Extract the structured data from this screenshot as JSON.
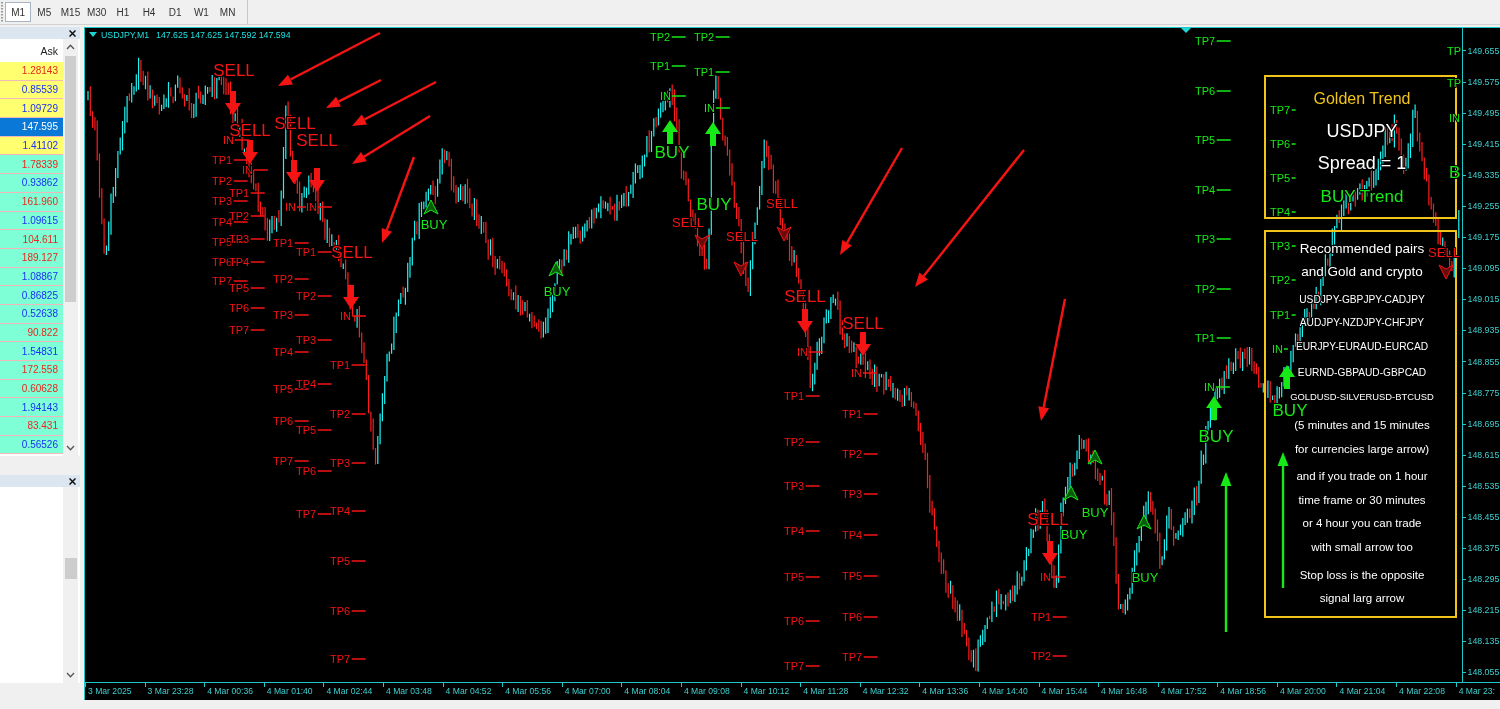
{
  "toolbar": {
    "timeframes": [
      {
        "label": "M1",
        "selected": true
      },
      {
        "label": "M5",
        "selected": false
      },
      {
        "label": "M15",
        "selected": false
      },
      {
        "label": "M30",
        "selected": false
      },
      {
        "label": "H1",
        "selected": false
      },
      {
        "label": "H4",
        "selected": false
      },
      {
        "label": "D1",
        "selected": false
      },
      {
        "label": "W1",
        "selected": false
      },
      {
        "label": "MN",
        "selected": false
      }
    ]
  },
  "market_watch": {
    "column": "Ask",
    "rows": [
      {
        "ask": "1.28143",
        "rising": false,
        "highlighted": true,
        "selected": false
      },
      {
        "ask": "0.85539",
        "rising": true,
        "highlighted": true,
        "selected": false
      },
      {
        "ask": "1.09729",
        "rising": true,
        "highlighted": true,
        "selected": false
      },
      {
        "ask": "147.595",
        "rising": true,
        "highlighted": true,
        "selected": true
      },
      {
        "ask": "1.41102",
        "rising": true,
        "highlighted": true,
        "selected": false
      },
      {
        "ask": "1.78339",
        "rising": false,
        "highlighted": false,
        "selected": false
      },
      {
        "ask": "0.93862",
        "rising": true,
        "highlighted": false,
        "selected": false
      },
      {
        "ask": "161.960",
        "rising": false,
        "highlighted": false,
        "selected": false
      },
      {
        "ask": "1.09615",
        "rising": true,
        "highlighted": false,
        "selected": false
      },
      {
        "ask": "104.611",
        "rising": false,
        "highlighted": false,
        "selected": false
      },
      {
        "ask": "189.127",
        "rising": false,
        "highlighted": false,
        "selected": false
      },
      {
        "ask": "1.08867",
        "rising": true,
        "highlighted": false,
        "selected": false
      },
      {
        "ask": "0.86825",
        "rising": true,
        "highlighted": false,
        "selected": false
      },
      {
        "ask": "0.52638",
        "rising": true,
        "highlighted": false,
        "selected": false
      },
      {
        "ask": "90.822",
        "rising": false,
        "highlighted": false,
        "selected": false
      },
      {
        "ask": "1.54831",
        "rising": true,
        "highlighted": false,
        "selected": false
      },
      {
        "ask": "172.558",
        "rising": false,
        "highlighted": false,
        "selected": false
      },
      {
        "ask": "0.60628",
        "rising": false,
        "highlighted": false,
        "selected": false
      },
      {
        "ask": "1.94143",
        "rising": true,
        "highlighted": false,
        "selected": false
      },
      {
        "ask": "83.431",
        "rising": false,
        "highlighted": false,
        "selected": false
      },
      {
        "ask": "0.56526",
        "rising": true,
        "highlighted": false,
        "selected": false
      }
    ]
  },
  "chart": {
    "title": "USDJPY,M1",
    "ohlc": "147.625 147.625 147.592 147.594",
    "price_axis": [
      "149.655",
      "149.575",
      "149.495",
      "149.415",
      "149.335",
      "149.255",
      "149.175",
      "149.095",
      "149.015",
      "148.935",
      "148.855",
      "148.775",
      "148.695",
      "148.615",
      "148.535",
      "148.455",
      "148.375",
      "148.295",
      "148.215",
      "148.135",
      "148.055"
    ],
    "time_axis": [
      "3 Mar 2025",
      "3 Mar 23:28",
      "4 Mar 00:36",
      "4 Mar 01:40",
      "4 Mar 02:44",
      "4 Mar 03:48",
      "4 Mar 04:52",
      "4 Mar 05:56",
      "4 Mar 07:00",
      "4 Mar 08:04",
      "4 Mar 09:08",
      "4 Mar 10:12",
      "4 Mar 11:28",
      "4 Mar 12:32",
      "4 Mar 13:36",
      "4 Mar 14:40",
      "4 Mar 15:44",
      "4 Mar 16:48",
      "4 Mar 17:52",
      "4 Mar 18:56",
      "4 Mar 20:00",
      "4 Mar 21:04",
      "4 Mar 22:08",
      "4 Mar 23:"
    ],
    "signals": [
      {
        "kind": "sell",
        "large": true,
        "label": "SELL",
        "entry": "IN",
        "targets": [
          "TP1",
          "TP2",
          "TP3",
          "TP4",
          "TP5",
          "TP6",
          "TP7"
        ]
      },
      {
        "kind": "sell",
        "large": true,
        "label": "SELL",
        "entry": "IN",
        "targets": [
          "TP1",
          "TP2",
          "TP3",
          "TP4",
          "TP5",
          "TP6",
          "TP7"
        ]
      },
      {
        "kind": "sell",
        "large": true,
        "label": "SELL",
        "entry": "IN",
        "targets": [
          "TP1",
          "TP2",
          "TP3",
          "TP4",
          "TP5",
          "TP6",
          "TP7"
        ]
      },
      {
        "kind": "sell",
        "large": true,
        "label": "SELL",
        "entry": "IN",
        "targets": [
          "TP1",
          "TP2",
          "TP3",
          "TP4",
          "TP5",
          "TP6",
          "TP7"
        ]
      },
      {
        "kind": "sell",
        "large": true,
        "label": "SELL",
        "entry": "IN",
        "targets": [
          "TP1",
          "TP2",
          "TP3",
          "TP4",
          "TP5",
          "TP6",
          "TP7"
        ]
      },
      {
        "kind": "buy",
        "large": false,
        "label": "BUY"
      },
      {
        "kind": "buy",
        "large": false,
        "label": "BUY"
      },
      {
        "kind": "buy",
        "large": true,
        "label": "BUY",
        "entry": "IN",
        "targets": [
          "TP2",
          "TP1"
        ]
      },
      {
        "kind": "buy",
        "large": true,
        "label": "BUY",
        "entry": "IN",
        "targets": [
          "TP2",
          "TP1"
        ]
      },
      {
        "kind": "sell",
        "large": false,
        "label": "SELL"
      },
      {
        "kind": "sell",
        "large": false,
        "label": "SELL"
      },
      {
        "kind": "sell",
        "large": false,
        "label": "SELL"
      },
      {
        "kind": "sell",
        "large": true,
        "label": "SELL",
        "entry": "IN",
        "targets": [
          "TP1",
          "TP2",
          "TP3",
          "TP4",
          "TP5",
          "TP6",
          "TP7"
        ]
      },
      {
        "kind": "sell",
        "large": true,
        "label": "SELL",
        "entry": "IN",
        "targets": [
          "TP1",
          "TP2",
          "TP3",
          "TP4",
          "TP5",
          "TP6",
          "TP7"
        ]
      },
      {
        "kind": "sell",
        "large": true,
        "label": "SELL",
        "entry": "IN",
        "targets": [
          "TP1",
          "TP2"
        ]
      },
      {
        "kind": "buy",
        "large": false,
        "label": "BUY"
      },
      {
        "kind": "buy",
        "large": false,
        "label": "BUY"
      },
      {
        "kind": "buy",
        "large": false,
        "label": "BUY"
      },
      {
        "kind": "buy",
        "large": true,
        "label": "BUY",
        "entry": "IN",
        "targets": [
          "TP7",
          "TP6",
          "TP5",
          "TP4",
          "TP3",
          "TP2",
          "TP1"
        ]
      },
      {
        "kind": "buy",
        "large": true,
        "label": "BUY",
        "entry": "IN",
        "targets": [
          "TP7",
          "TP6",
          "TP5",
          "TP4",
          "TP3",
          "TP2",
          "TP1"
        ]
      },
      {
        "kind": "sell",
        "large": false,
        "label": "SELL"
      }
    ],
    "cut_labels": [
      {
        "kind": "level",
        "text": "TP"
      },
      {
        "kind": "level",
        "text": "TP"
      },
      {
        "kind": "level",
        "text": "IN"
      },
      {
        "kind": "signal",
        "text": "B"
      }
    ],
    "summary": {
      "title": "Golden Trend",
      "symbol": "USDJPY",
      "spread": "Spread = 1",
      "trend": {
        "kind": "buy",
        "text": "BUY Trend"
      }
    },
    "notes": [
      {
        "kind": "heading",
        "text": "Recommended pairs"
      },
      {
        "kind": "heading",
        "text": "and Gold and crypto"
      },
      {
        "kind": "pairs",
        "text": "USDJPY-GBPJPY-CADJPY"
      },
      {
        "kind": "pairs",
        "text": "AUDJPY-NZDJPY-CHFJPY"
      },
      {
        "kind": "pairs",
        "text": "EURJPY-EURAUD-EURCAD"
      },
      {
        "kind": "pairs",
        "text": "EURND-GBPAUD-GBPCAD"
      },
      {
        "kind": "small",
        "text": "GOLDUSD-SILVERUSD-BTCUSD"
      },
      {
        "kind": "note",
        "text": "(5 minutes and 15 minutes"
      },
      {
        "kind": "note",
        "text": "for currencies large arrow)"
      },
      {
        "kind": "note",
        "text": "and if you trade on 1 hour"
      },
      {
        "kind": "note",
        "text": "time frame or 30 minutes"
      },
      {
        "kind": "note",
        "text": "or 4 hour you can trade"
      },
      {
        "kind": "note",
        "text": "with small arrow too"
      },
      {
        "kind": "note",
        "text": "Stop loss is the opposite"
      },
      {
        "kind": "note",
        "text": "signal larg arrow"
      }
    ]
  }
}
